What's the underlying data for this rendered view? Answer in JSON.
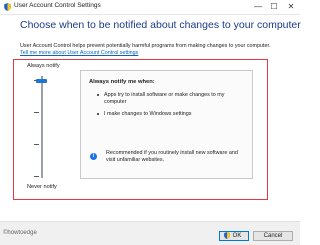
{
  "window": {
    "title": "User Account Control Settings",
    "controls": [
      "—",
      "☐",
      "✕"
    ]
  },
  "main": {
    "heading": "Choose when to be notified about changes to your computer",
    "description": "User Account Control helps prevent potentially harmful programs from making changes to your computer.",
    "help_link": "Tell me more about User Account Control settings"
  },
  "slider": {
    "top_label": "Always notify",
    "bottom_label": "Never notify",
    "level": 4,
    "levels": 4
  },
  "panel": {
    "title": "Always notify me when:",
    "bullets": [
      "Apps try to install software or make changes to my computer",
      "I make changes to Windows settings"
    ],
    "recommendation": "Recommended if you routinely install new software and visit unfamiliar websites."
  },
  "footer": {
    "watermark": "©howtoedge",
    "ok_label": "OK",
    "cancel_label": "Cancel"
  },
  "colors": {
    "accent": "#1976d2",
    "highlight": "#e23a44",
    "heading": "#1e3a8a",
    "link": "#0b63c1"
  }
}
